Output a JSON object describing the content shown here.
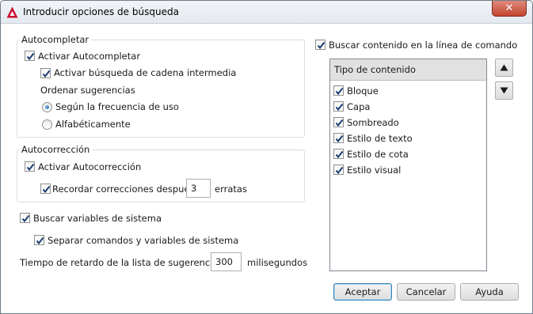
{
  "window": {
    "title": "Introducir opciones de búsqueda",
    "close_label": "✕"
  },
  "autocompletar": {
    "legend": "Autocompletar",
    "activar": {
      "label": "Activar Autocompletar",
      "checked": true
    },
    "cadena_intermedia": {
      "label": "Activar búsqueda de cadena intermedia",
      "checked": true
    },
    "ordenar_label": "Ordenar sugerencias",
    "orden_frecuencia": {
      "label": "Según la frecuencia de uso",
      "selected": true
    },
    "orden_alfabetico": {
      "label": "Alfabéticamente",
      "selected": false
    }
  },
  "autocorreccion": {
    "legend": "Autocorrección",
    "activar": {
      "label": "Activar Autocorrección",
      "checked": true
    },
    "recordar": {
      "label": "Recordar correcciones después",
      "checked": true,
      "value": "3",
      "suffix": "erratas"
    }
  },
  "variables": {
    "buscar": {
      "label": "Buscar variables de sistema",
      "checked": true
    },
    "separar": {
      "label": "Separar comandos y variables de sistema",
      "checked": true
    }
  },
  "retardo": {
    "label": "Tiempo de retardo de la lista de sugerencias",
    "value": "300",
    "unit": "milisegundos"
  },
  "contenido": {
    "label": "Buscar contenido en la línea de comando",
    "checked": true,
    "header": "Tipo de contenido",
    "items": [
      {
        "label": "Bloque",
        "checked": true
      },
      {
        "label": "Capa",
        "checked": true
      },
      {
        "label": "Sombreado",
        "checked": true
      },
      {
        "label": "Estilo de texto",
        "checked": true
      },
      {
        "label": "Estilo de cota",
        "checked": true
      },
      {
        "label": "Estilo visual",
        "checked": true
      }
    ]
  },
  "buttons": {
    "aceptar": "Aceptar",
    "cancelar": "Cancelar",
    "ayuda": "Ayuda"
  },
  "icons": {
    "app": "autocad-logo-icon",
    "up": "arrow-up-icon",
    "down": "arrow-down-icon"
  },
  "colors": {
    "brand": "#c8102e",
    "close": "#c2452f",
    "radio": "#1e5fa8"
  }
}
